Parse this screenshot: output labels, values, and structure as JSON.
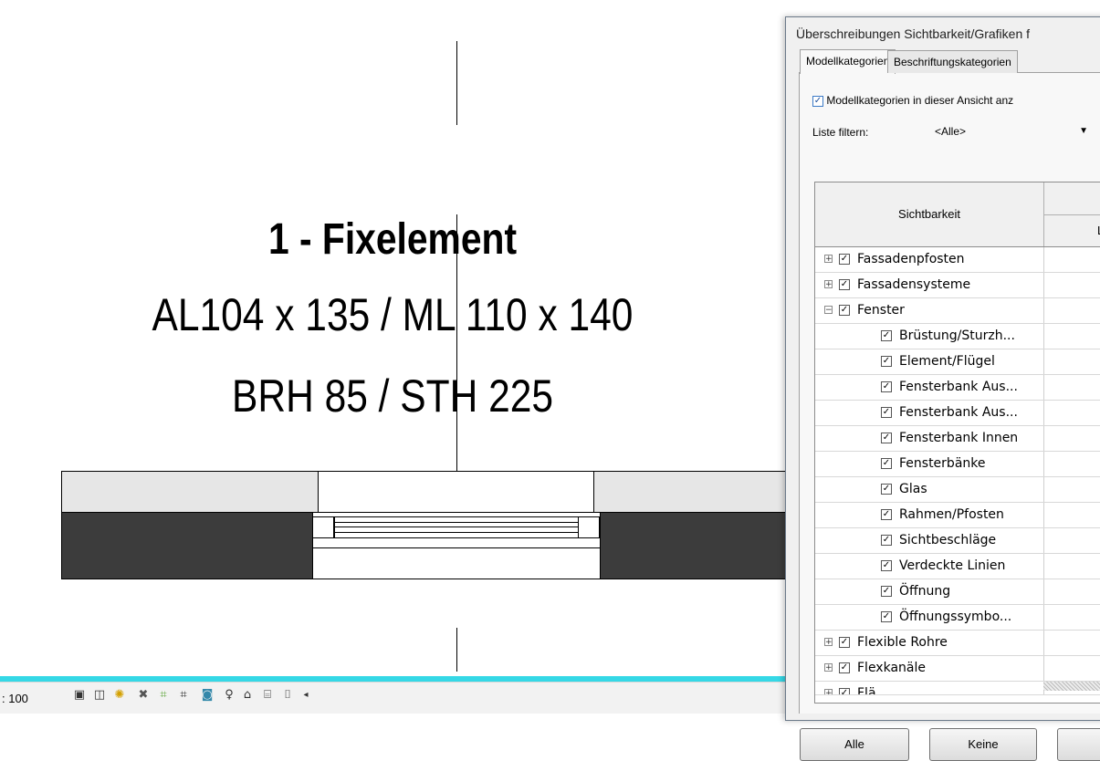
{
  "canvas": {
    "tag_line1": "1 - Fixelement",
    "tag_line2": "AL104 x 135 / ML 110 x 140",
    "tag_line3": "BRH 85 / STH 225"
  },
  "status": {
    "scale": ": 100",
    "icons": [
      "detail-level-icon",
      "visual-style-icon",
      "sun-path-icon",
      "shadows-icon",
      "crop-view-icon",
      "show-crop-icon",
      "temporary-hide-icon",
      "reveal-hidden-icon",
      "lock-3d-icon",
      "analytical-model-icon",
      "highlight-displacement-icon",
      "scroll-left-icon"
    ]
  },
  "dialog": {
    "title": "Überschreibungen Sichtbarkeit/Grafiken f",
    "tabs": [
      "Modellkategorien",
      "Beschriftungskategorien"
    ],
    "show_categories_label": "Modellkategorien in dieser Ansicht anz",
    "filter_label": "Liste filtern:",
    "filter_value": "<Alle>",
    "table": {
      "header_visibility": "Sichtbarkeit",
      "header_col2": "L",
      "rows": [
        {
          "label": "Fassadenpfosten",
          "level": 0,
          "expander": "+",
          "checked": true
        },
        {
          "label": "Fassadensysteme",
          "level": 0,
          "expander": "+",
          "checked": true
        },
        {
          "label": "Fenster",
          "level": 0,
          "expander": "-",
          "checked": true
        },
        {
          "label": "Brüstung/Sturzh...",
          "level": 1,
          "checked": true
        },
        {
          "label": "Element/Flügel",
          "level": 1,
          "checked": true
        },
        {
          "label": "Fensterbank Aus...",
          "level": 1,
          "checked": true
        },
        {
          "label": "Fensterbank Aus...",
          "level": 1,
          "checked": true
        },
        {
          "label": "Fensterbank Innen",
          "level": 1,
          "checked": true
        },
        {
          "label": "Fensterbänke",
          "level": 1,
          "checked": true
        },
        {
          "label": "Glas",
          "level": 1,
          "checked": true
        },
        {
          "label": "Rahmen/Pfosten",
          "level": 1,
          "checked": true
        },
        {
          "label": "Sichtbeschläge",
          "level": 1,
          "checked": true
        },
        {
          "label": "Verdeckte Linien",
          "level": 1,
          "checked": true
        },
        {
          "label": "Öffnung",
          "level": 1,
          "checked": true
        },
        {
          "label": "Öffnungssymbo...",
          "level": 1,
          "checked": true
        },
        {
          "label": "Flexible Rohre",
          "level": 0,
          "expander": "+",
          "checked": true
        },
        {
          "label": "Flexkanäle",
          "level": 0,
          "expander": "+",
          "checked": true
        },
        {
          "label": "Flä...",
          "level": 0,
          "expander": "+",
          "checked": true
        }
      ]
    },
    "buttons": {
      "all": "Alle",
      "none": "Keine"
    }
  }
}
